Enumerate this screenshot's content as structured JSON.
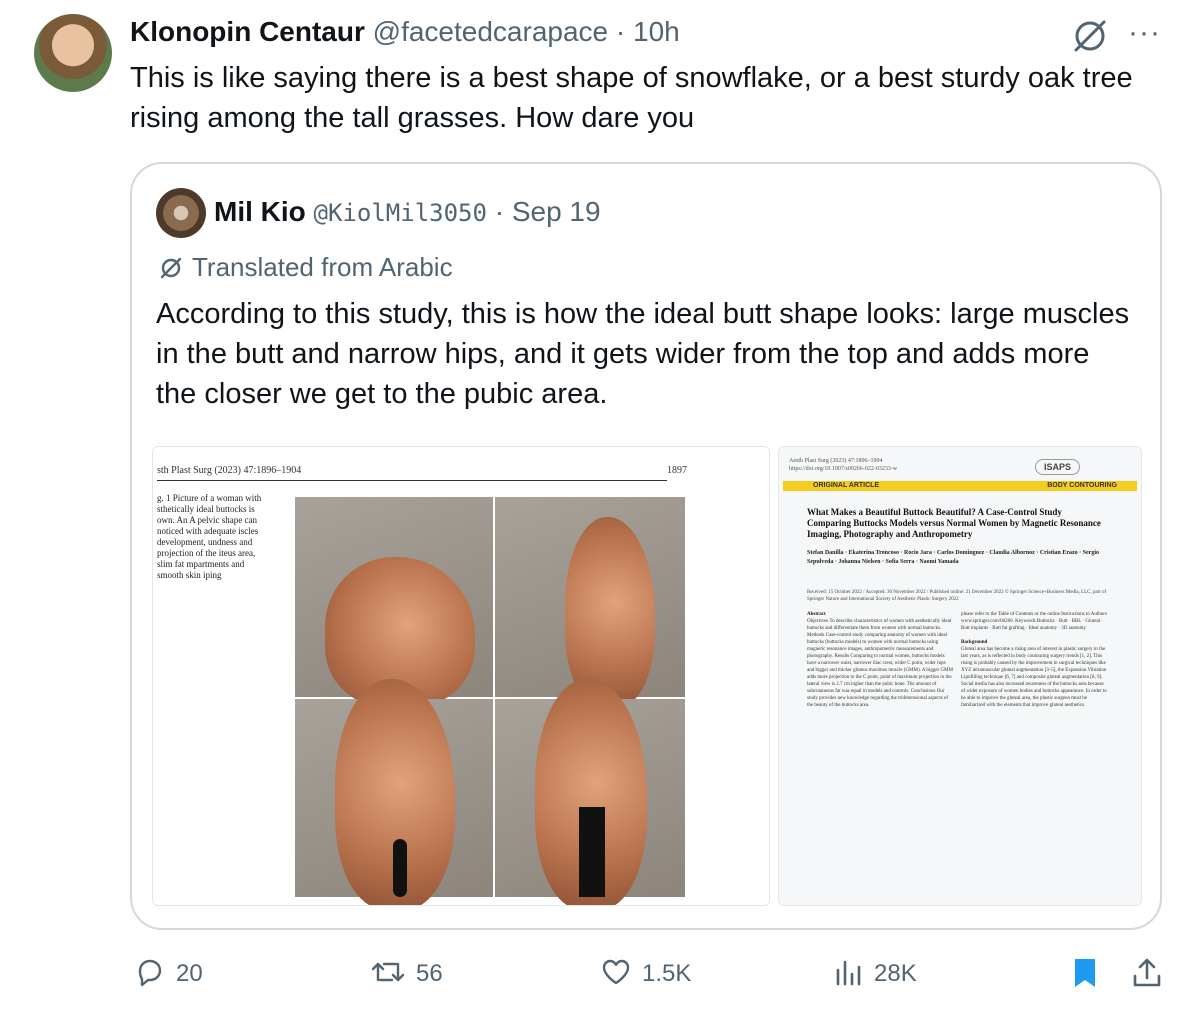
{
  "tweet": {
    "author_name": "Klonopin Centaur",
    "author_handle": "@facetedcarapace",
    "separator": "·",
    "time": "10h",
    "more_label": "···",
    "text": "This is like saying there is a best shape of snowflake, or a best sturdy oak tree rising among the tall grasses. How dare you"
  },
  "quote": {
    "author_name": "Mil Kio",
    "author_handle": "@KiolMil3050",
    "separator": "·",
    "time": "Sep 19",
    "translated_label": "Translated from Arabic",
    "text": "According to this study, this is how the ideal butt shape looks: large muscles in the butt and narrow hips, and it gets wider from the top and adds more the closer we get to the pubic area.",
    "image1": {
      "header_left": "sth Plast Surg (2023) 47:1896–1904",
      "header_right": "1897",
      "caption": "g. 1 Picture of a woman with sthetically ideal buttocks is own. An A pelvic shape can noticed with adequate iscles development, undness and projection of the iteus area, slim fat mpartments and smooth skin iping"
    },
    "image2": {
      "top_meta": "Aesth Plast Surg (2023) 47:1896–1904 https://doi.org/10.1007/s00266-022-03233-w",
      "logo": "ISAPS",
      "bar_left": "ORIGINAL ARTICLE",
      "bar_right": "BODY CONTOURING",
      "title": "What Makes a Beautiful Buttock Beautiful? A Case-Control Study Comparing Buttocks Models versus Normal Women by Magnetic Resonance Imaging, Photography and Anthropometry",
      "authors": "Stefan Danilla · Ekaterina Troncoso · Rocio Jara · Carlos Dominguez · Claudia Albornoz · Cristian Erazo · Sergio Sepulveda · Johanna Nielsen · Sofia Serra · Naomi Yamada",
      "received": "Received: 15 October 2022 / Accepted: 30 November 2022 / Published online: 21 December 2022 © Springer Science+Business Media, LLC, part of Springer Nature and International Society of Aesthetic Plastic Surgery 2022",
      "abstract_heading": "Abstract",
      "abstract_text": "Objectives To describe characteristics of women with aesthetically ideal buttocks and differentiate them from women with normal buttocks. Methods Case-control study comparing anatomy of women with ideal buttocks (buttocks models) to women with normal buttocks using magnetic resonance images, anthropometric measurements and photography. Results Comparing to normal women, buttocks models have a narrower waist, narrower iliac crest, wider C point, wider hips and bigger and thicker gluteus maximus muscle (GMM). A bigger GMM adds more projection to the C point, point of maximum projection in the lateral view is 2.7 cm higher than the pubic bone. The amount of subcutaneous fat was equal in models and controls. Conclusions Our study provides new knowledge regarding the tridimensional aspects of the beauty of the buttocks area.",
      "keywords_text": "please refer to the Table of Contents or the online Instructions to Authors www.springer.com/00266. Keywords Buttocks · Butt · BBL · Gluteal · Butt implants · Butt fat grafting · Ideal anatomy · 3D anatomy",
      "background_heading": "Background",
      "background_text": "Gluteal area has become a rising area of interest in plastic surgery in the last years, as is reflected in body contouring surgery trends [1, 2]. This rising is probably caused by the improvement in surgical techniques like XYZ intramuscular gluteal augmentation [3–5], the Expansion Vibration Lipofilling technique [6, 7] and composite gluteal augmentation [8, 9]. Social media has also increased awareness of the buttocks area because of wider exposure of women bodies and buttocks appearance. In order to be able to improve the gluteal area, the plastic surgeon must be familiarized with the elements that improve gluteal aesthetics."
    }
  },
  "actions": {
    "replies": "20",
    "reposts": "56",
    "likes": "1.5K",
    "views": "28K"
  },
  "icons": [
    "translate-icon",
    "more-icon",
    "reply-icon",
    "repost-icon",
    "like-icon",
    "views-icon",
    "bookmark-icon",
    "share-icon"
  ],
  "colors": {
    "text": "#0f1419",
    "secondary": "#536471",
    "border": "#cfd9de",
    "bookmark": "#1d9bf0",
    "journal_bar": "#f4cd1e"
  }
}
